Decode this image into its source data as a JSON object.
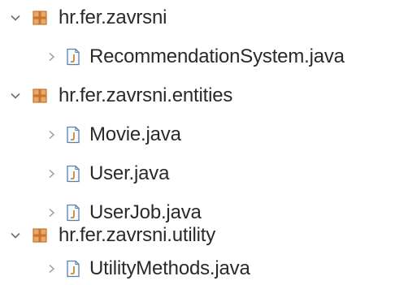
{
  "tree": {
    "packages": [
      {
        "name": "hr.fer.zavrsni",
        "expanded": true,
        "files": [
          "RecommendationSystem.java"
        ]
      },
      {
        "name": "hr.fer.zavrsni.entities",
        "expanded": true,
        "files": [
          "Movie.java",
          "User.java",
          "UserJob.java"
        ]
      },
      {
        "name": "hr.fer.zavrsni.utility",
        "expanded": true,
        "files": [
          "UtilityMethods.java"
        ]
      }
    ]
  },
  "icons": {
    "package": "package-icon",
    "java_file": "java-file-icon",
    "expanded": "chevron-down-icon",
    "collapsed": "chevron-right-icon"
  },
  "colors": {
    "package_icon": "#c8742f",
    "package_icon_light": "#e8a867",
    "java_icon_border": "#5b7fa8",
    "java_icon_letter": "#c88a2a",
    "chevron": "#6e6e6e",
    "text": "#2a2a2a"
  }
}
